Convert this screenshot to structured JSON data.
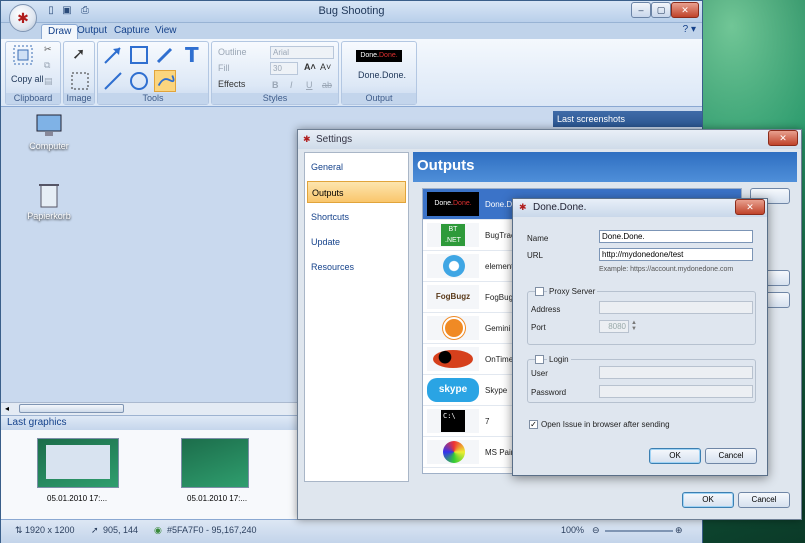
{
  "app": {
    "title": "Bug Shooting"
  },
  "tabs": [
    "Draw",
    "Output",
    "Capture",
    "View"
  ],
  "ribbon": {
    "copy_all": "Copy all",
    "clipboard": "Clipboard",
    "image": "Image",
    "tools": "Tools",
    "styles": "Styles",
    "output": "Output",
    "outline": "Outline",
    "fill": "Fill",
    "effects": "Effects",
    "font": "Arial",
    "size": "30",
    "output_name": "Done.Done."
  },
  "desktop": {
    "computer": "Computer",
    "trash": "Papierkorb"
  },
  "last_graphics": {
    "title": "Last graphics",
    "items": [
      {
        "date": "05.01.2010 17:..."
      },
      {
        "date": "05.01.2010 17:..."
      }
    ]
  },
  "last_screenshots": "Last screenshots",
  "status": {
    "resolution": "1920 x 1200",
    "cursor": "905, 144",
    "color": "#5FA7F0 - 95,167,240",
    "zoom": "100%"
  },
  "settings": {
    "title": "Settings",
    "nav": [
      "General",
      "Outputs",
      "Shortcuts",
      "Update",
      "Resources"
    ],
    "header": "Outputs",
    "outputs": [
      "Done.D",
      "BugTrac",
      "element",
      "FogBugz",
      "Gemini",
      "OnTime",
      "Skype",
      "7",
      "MS Pain"
    ],
    "ok": "OK",
    "cancel": "Cancel"
  },
  "dialog": {
    "title": "Done.Done.",
    "name_label": "Name",
    "name_value": "Done.Done.",
    "url_label": "URL",
    "url_value": "http://mydonedone/test",
    "example": "Example: https://account.mydonedone.com",
    "proxy": "Proxy Server",
    "address": "Address",
    "port": "Port",
    "port_value": "8080",
    "login": "Login",
    "user": "User",
    "password": "Password",
    "open_issue": "Open Issue in browser after sending",
    "ok": "OK",
    "cancel": "Cancel"
  }
}
